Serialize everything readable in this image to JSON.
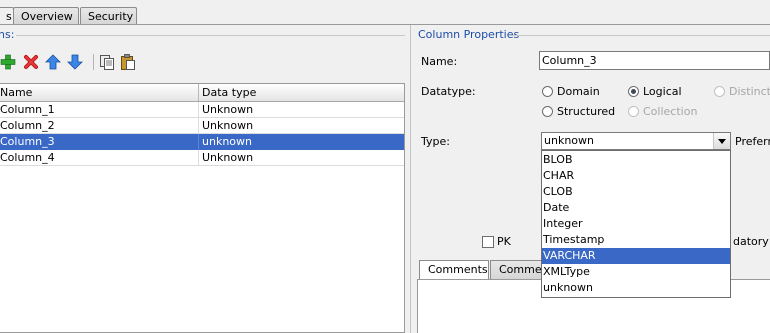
{
  "tabs": [
    {
      "label": "s",
      "active": true
    },
    {
      "label": "Overview",
      "active": false
    },
    {
      "label": "Security",
      "active": false
    }
  ],
  "left": {
    "group_label": "ns:",
    "toolbar": [
      {
        "icon": "add-icon",
        "color": "#27a027"
      },
      {
        "icon": "delete-icon",
        "color": "#d62525"
      },
      {
        "icon": "move-up-icon",
        "color": "#2b6fd0"
      },
      {
        "icon": "move-down-icon",
        "color": "#2b6fd0"
      },
      {
        "icon": "copy-icon"
      },
      {
        "icon": "paste-icon"
      }
    ],
    "table": {
      "headers": [
        "Name",
        "Data type"
      ],
      "rows": [
        {
          "name": "Column_1",
          "type": "Unknown",
          "selected": false
        },
        {
          "name": "Column_2",
          "type": "Unknown",
          "selected": false
        },
        {
          "name": "Column_3",
          "type": "unknown",
          "selected": true
        },
        {
          "name": "Column_4",
          "type": "Unknown",
          "selected": false
        }
      ]
    }
  },
  "right": {
    "group_label": "Column Properties",
    "name_label": "Name:",
    "name_value": "Column_3",
    "datatype_label": "Datatype:",
    "datatype_options": [
      {
        "label": "Domain",
        "selected": false,
        "enabled": true
      },
      {
        "label": "Logical",
        "selected": true,
        "enabled": true
      },
      {
        "label": "Distinct",
        "selected": false,
        "enabled": false
      },
      {
        "label": "Structured",
        "selected": false,
        "enabled": true
      },
      {
        "label": "Collection",
        "selected": false,
        "enabled": false
      }
    ],
    "type_label": "Type:",
    "type_value": "unknown",
    "preferred_label": "Preferr",
    "type_options": [
      "BLOB",
      "CHAR",
      "CLOB",
      "Date",
      "Integer",
      "Timestamp",
      "VARCHAR",
      "XMLType",
      "unknown"
    ],
    "type_highlighted": "VARCHAR",
    "pk_label": "PK",
    "mandatory_label": "datory",
    "bottom_tabs": [
      {
        "label": "Comments",
        "active": true
      },
      {
        "label": "Comme",
        "active": false
      }
    ]
  },
  "colors": {
    "selection": "#3968c6",
    "group_label": "#1c4ea8"
  }
}
